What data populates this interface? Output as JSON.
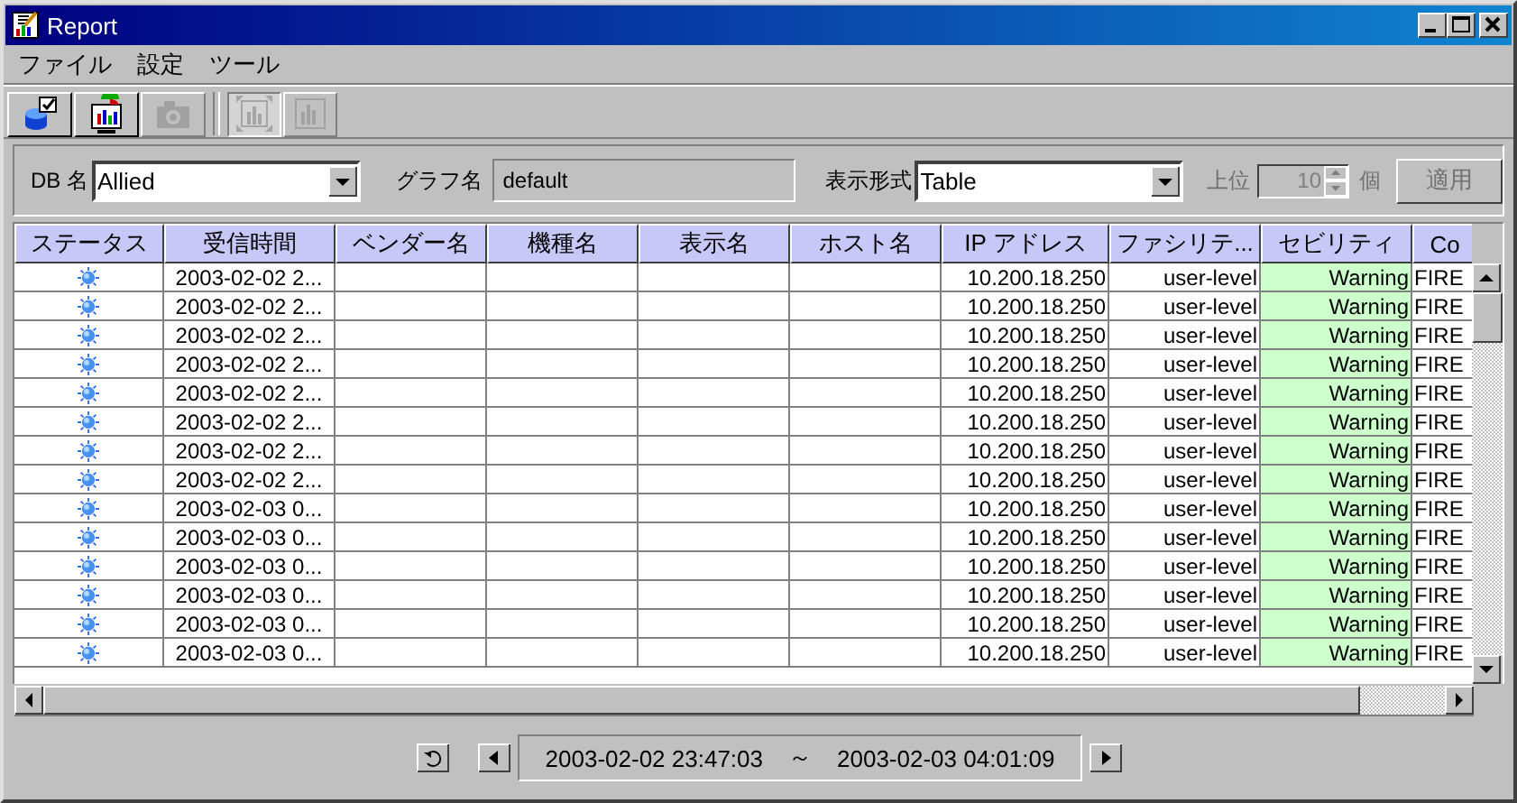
{
  "window": {
    "title": "Report"
  },
  "menu": [
    "ファイル",
    "設定",
    "ツール"
  ],
  "toolbar": [
    {
      "kind": "database",
      "disabled": false,
      "pressed": false
    },
    {
      "kind": "monitor",
      "disabled": false,
      "pressed": false
    },
    {
      "kind": "camera",
      "disabled": true,
      "pressed": false
    },
    {
      "kind": "expand",
      "disabled": true,
      "pressed": true
    },
    {
      "kind": "chart",
      "disabled": true,
      "pressed": false
    }
  ],
  "filter": {
    "db": {
      "label": "DB 名",
      "value": "Allied"
    },
    "graph": {
      "label": "グラフ名",
      "value": "default"
    },
    "format": {
      "label": "表示形式",
      "value": "Table"
    },
    "top": {
      "label": "上位",
      "value": "10",
      "unit": "個",
      "disabled": true
    },
    "apply": {
      "label": "適用",
      "disabled": true
    }
  },
  "table": {
    "columns": [
      "ステータス",
      "受信時間",
      "ベンダー名",
      "機種名",
      "表示名",
      "ホスト名",
      "IP アドレス",
      "ファシリテ...",
      "セビリティ",
      "Co"
    ],
    "rows": [
      {
        "kind": "info",
        "received": "2003-02-02 2...",
        "ip": "10.200.18.250",
        "facility": "user-level",
        "severity": "Warning",
        "color": "#ccffcc",
        "column_10": "FIRE"
      },
      {
        "kind": "info",
        "received": "2003-02-02 2...",
        "ip": "10.200.18.250",
        "facility": "user-level",
        "severity": "Warning",
        "color": "#ccffcc",
        "column_10": "FIRE"
      },
      {
        "kind": "info",
        "received": "2003-02-02 2...",
        "ip": "10.200.18.250",
        "facility": "user-level",
        "severity": "Warning",
        "color": "#ccffcc",
        "column_10": "FIRE"
      },
      {
        "kind": "info",
        "received": "2003-02-02 2...",
        "ip": "10.200.18.250",
        "facility": "user-level",
        "severity": "Warning",
        "color": "#ccffcc",
        "column_10": "FIRE"
      },
      {
        "kind": "info",
        "received": "2003-02-02 2...",
        "ip": "10.200.18.250",
        "facility": "user-level",
        "severity": "Warning",
        "color": "#ccffcc",
        "column_10": "FIRE"
      },
      {
        "kind": "info",
        "received": "2003-02-02 2...",
        "ip": "10.200.18.250",
        "facility": "user-level",
        "severity": "Warning",
        "color": "#ccffcc",
        "column_10": "FIRE"
      },
      {
        "kind": "info",
        "received": "2003-02-02 2...",
        "ip": "10.200.18.250",
        "facility": "user-level",
        "severity": "Warning",
        "color": "#ccffcc",
        "column_10": "FIRE"
      },
      {
        "kind": "info",
        "received": "2003-02-02 2...",
        "ip": "10.200.18.250",
        "facility": "user-level",
        "severity": "Warning",
        "color": "#ccffcc",
        "column_10": "FIRE"
      },
      {
        "kind": "info",
        "received": "2003-02-03 0...",
        "ip": "10.200.18.250",
        "facility": "user-level",
        "severity": "Warning",
        "color": "#ccffcc",
        "column_10": "FIRE"
      },
      {
        "kind": "info",
        "received": "2003-02-03 0...",
        "ip": "10.200.18.250",
        "facility": "user-level",
        "severity": "Warning",
        "color": "#ccffcc",
        "column_10": "FIRE"
      },
      {
        "kind": "info",
        "received": "2003-02-03 0...",
        "ip": "10.200.18.250",
        "facility": "user-level",
        "severity": "Warning",
        "color": "#ccffcc",
        "column_10": "FIRE"
      },
      {
        "kind": "info",
        "received": "2003-02-03 0...",
        "ip": "10.200.18.250",
        "facility": "user-level",
        "severity": "Warning",
        "color": "#ccffcc",
        "column_10": "FIRE"
      },
      {
        "kind": "info",
        "received": "2003-02-03 0...",
        "ip": "10.200.18.250",
        "facility": "user-level",
        "severity": "Warning",
        "color": "#ccffcc",
        "column_10": "FIRE"
      },
      {
        "kind": "info",
        "received": "2003-02-03 0...",
        "ip": "10.200.18.250",
        "facility": "user-level",
        "severity": "Warning",
        "color": "#ccffcc",
        "column_10": "FIRE"
      }
    ]
  },
  "navigator": {
    "start": "2003-02-02 23:47:03",
    "separator": "～",
    "end": "2003-02-03 04:01:09"
  }
}
